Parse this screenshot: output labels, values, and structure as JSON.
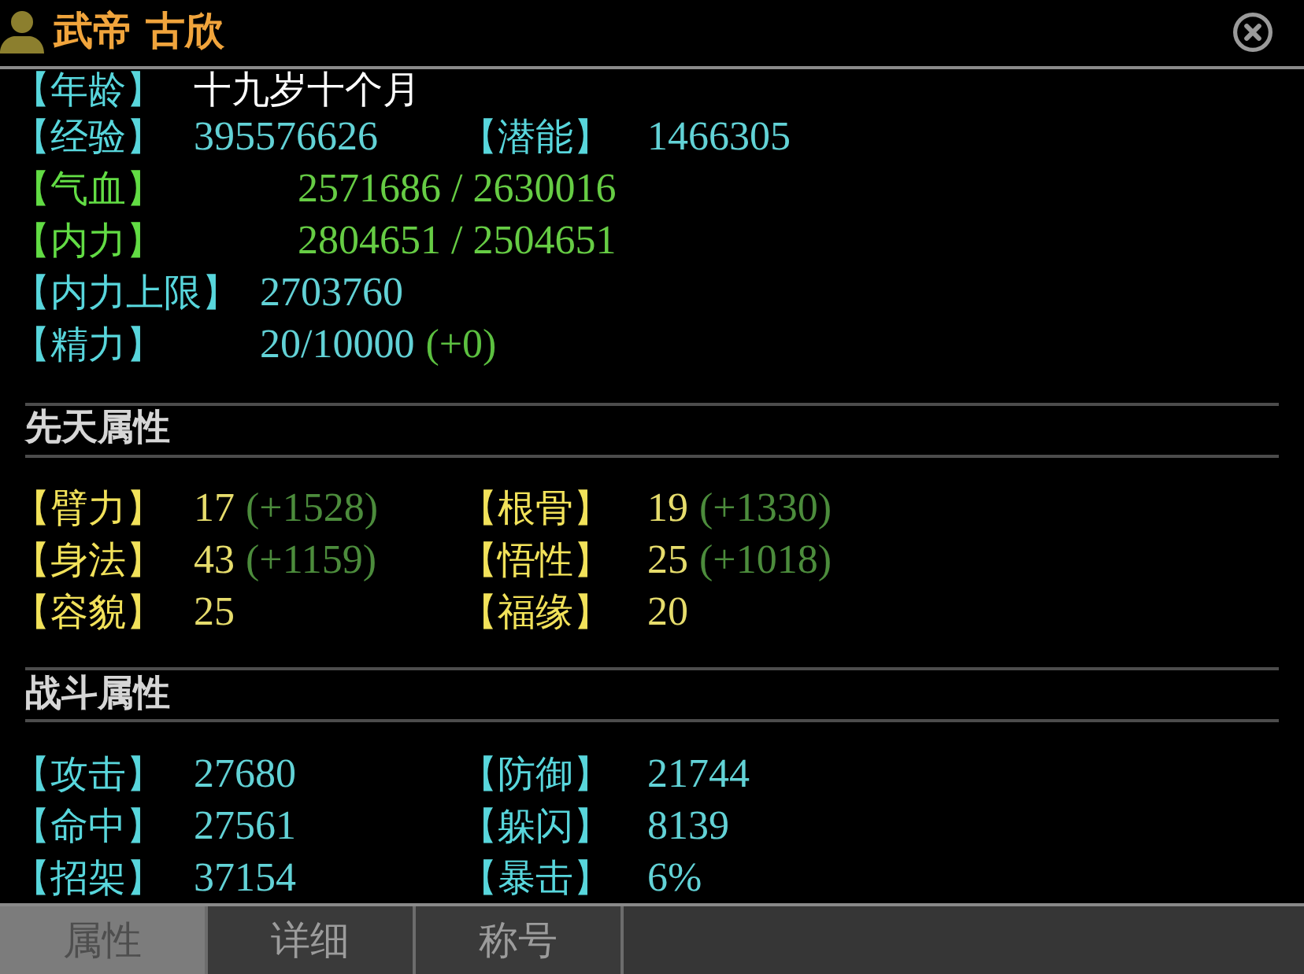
{
  "window": {
    "title": "武帝 古欣"
  },
  "overview": [
    {
      "cells": [
        {
          "kind": "text",
          "label": "【年龄】",
          "value": "十九岁十个月"
        }
      ]
    },
    {
      "cells": [
        {
          "kind": "number",
          "label": "【经验】",
          "value": "395576626"
        },
        {
          "kind": "number",
          "label": "【潜能】",
          "value": "1466305"
        }
      ]
    },
    {
      "cells": [
        {
          "kind": "meter",
          "label": "【气血】",
          "value": "2571686 / 2630016"
        }
      ]
    },
    {
      "cells": [
        {
          "kind": "meter",
          "label": "【内力】",
          "value": "2804651 / 2504651"
        }
      ]
    },
    {
      "cells": [
        {
          "kind": "limit",
          "label": "【内力上限】",
          "value": "2703760"
        }
      ]
    },
    {
      "cells": [
        {
          "kind": "limit",
          "label": "【精力】",
          "value": "20/10000",
          "bonus": "(+0)"
        }
      ]
    }
  ],
  "sections": [
    {
      "title": "先天属性",
      "rows": [
        {
          "cells": [
            {
              "kind": "innate",
              "label": "【臂力】",
              "value": "17",
              "bonus": "(+1528)"
            },
            {
              "kind": "innate",
              "label": "【根骨】",
              "value": "19",
              "bonus": "(+1330)"
            }
          ]
        },
        {
          "cells": [
            {
              "kind": "innate",
              "label": "【身法】",
              "value": "43",
              "bonus": "(+1159)"
            },
            {
              "kind": "innate",
              "label": "【悟性】",
              "value": "25",
              "bonus": "(+1018)"
            }
          ]
        },
        {
          "cells": [
            {
              "kind": "innate",
              "label": "【容貌】",
              "value": "25"
            },
            {
              "kind": "innate",
              "label": "【福缘】",
              "value": "20"
            }
          ]
        }
      ]
    },
    {
      "title": "战斗属性",
      "rows": [
        {
          "cells": [
            {
              "kind": "number",
              "label": "【攻击】",
              "value": "27680"
            },
            {
              "kind": "number",
              "label": "【防御】",
              "value": "21744"
            }
          ]
        },
        {
          "cells": [
            {
              "kind": "number",
              "label": "【命中】",
              "value": "27561"
            },
            {
              "kind": "number",
              "label": "【躲闪】",
              "value": "8139"
            }
          ]
        },
        {
          "cells": [
            {
              "kind": "number",
              "label": "【招架】",
              "value": "37154"
            },
            {
              "kind": "number",
              "label": "【暴击】",
              "value": "6%"
            }
          ]
        }
      ]
    }
  ],
  "tabs": [
    {
      "label": "属性",
      "selected": true
    },
    {
      "label": "详细",
      "selected": false
    },
    {
      "label": "称号",
      "selected": false
    }
  ]
}
